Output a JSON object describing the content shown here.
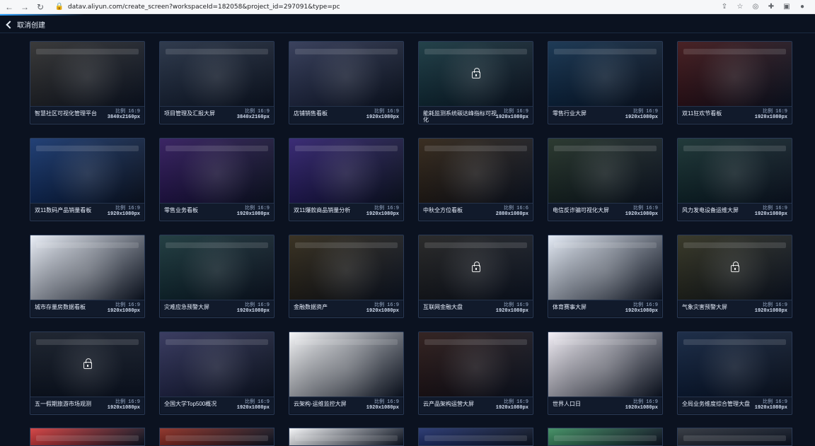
{
  "browser": {
    "url": "datav.aliyun.com/create_screen?workspaceId=182058&project_id=297091&type=pc"
  },
  "topbar": {
    "back_label": "取消创建"
  },
  "templates": [
    {
      "title": "智慧社区可视化管理平台",
      "ratio": "比例 16:9",
      "size": "3840x2160px",
      "theme_color": "#2a2a2a"
    },
    {
      "title": "项目管理及汇报大屏",
      "ratio": "比例 16:9",
      "size": "3840x2160px",
      "theme_color": "#1f2b3f"
    },
    {
      "title": "店铺销售看板",
      "ratio": "比例 16:9",
      "size": "1920x1080px",
      "theme_color": "#2a3250"
    },
    {
      "title": "能耗监测系统碳达峰指标可视化",
      "ratio": "比例 16:9",
      "size": "1920x1080px",
      "theme_color": "#11323b",
      "locked": true
    },
    {
      "title": "零售行业大屏",
      "ratio": "比例 16:9",
      "size": "1920x1080px",
      "theme_color": "#0b2a48"
    },
    {
      "title": "双11狂欢节看板",
      "ratio": "比例 16:9",
      "size": "1920x1080px",
      "theme_color": "#3a0f12"
    },
    {
      "title": "双11数码产品销量看板",
      "ratio": "比例 16:9",
      "size": "1920x1080px",
      "theme_color": "#10316b"
    },
    {
      "title": "零售业务看板",
      "ratio": "比例 16:9",
      "size": "1920x1080px",
      "theme_color": "#2b1358"
    },
    {
      "title": "双11爆款商品销量分析",
      "ratio": "比例 16:9",
      "size": "1920x1080px",
      "theme_color": "#2b1b6b"
    },
    {
      "title": "中秋全方位看板",
      "ratio": "比例 16:6",
      "size": "2880x1080px",
      "theme_color": "#2a1d0f"
    },
    {
      "title": "电信反诈骗可视化大屏",
      "ratio": "比例 16:9",
      "size": "1920x1080px",
      "theme_color": "#1b2a20"
    },
    {
      "title": "风力发电设备运维大屏",
      "ratio": "比例 16:9",
      "size": "1920x1080px",
      "theme_color": "#0f2a2a"
    },
    {
      "title": "城市存量房数据看板",
      "ratio": "比例 16:9",
      "size": "1920x1080px",
      "theme_color": "#e9eef7"
    },
    {
      "title": "灾难应急预警大屏",
      "ratio": "比例 16:9",
      "size": "1920x1080px",
      "theme_color": "#123034"
    },
    {
      "title": "金融数据资产",
      "ratio": "比例 16:9",
      "size": "1920x1080px",
      "theme_color": "#2a2212"
    },
    {
      "title": "互联网金融大盘",
      "ratio": "比例 16:9",
      "size": "1920x1080px",
      "theme_color": "#1a1a1a",
      "locked": true
    },
    {
      "title": "体育赛事大屏",
      "ratio": "比例 16:9",
      "size": "1920x1080px",
      "theme_color": "#e3eaf5"
    },
    {
      "title": "气象灾害预警大屏",
      "ratio": "比例 16:9",
      "size": "1920x1080px",
      "theme_color": "#2a2a19",
      "locked": true
    },
    {
      "title": "五一假期旅游市场观测",
      "ratio": "比例 16:9",
      "size": "1920x1080px",
      "theme_color": "#0d1420",
      "locked": true
    },
    {
      "title": "全国大学Top500概况",
      "ratio": "比例 16:9",
      "size": "1920x1080px",
      "theme_color": "#2b2d55"
    },
    {
      "title": "云架构-运维监控大屏",
      "ratio": "比例 16:9",
      "size": "1920x1080px",
      "theme_color": "#f4f5f7"
    },
    {
      "title": "云产品架构运营大屏",
      "ratio": "比例 16:9",
      "size": "1920x1080px",
      "theme_color": "#241210"
    },
    {
      "title": "世界人口日",
      "ratio": "比例 16:9",
      "size": "1920x1080px",
      "theme_color": "#f2eef6"
    },
    {
      "title": "全局业务维度综合管理大盘",
      "ratio": "比例 16:9",
      "size": "1920x1080px",
      "theme_color": "#0b1d3a"
    }
  ],
  "partial_row": [
    {
      "theme_color": "#d23a3a"
    },
    {
      "theme_color": "#8b2a1f"
    },
    {
      "theme_color": "#f5f6f8"
    },
    {
      "theme_color": "#1f2f6b"
    },
    {
      "theme_color": "#3b8b5e"
    },
    {
      "theme_color": "#2a2f38"
    }
  ]
}
